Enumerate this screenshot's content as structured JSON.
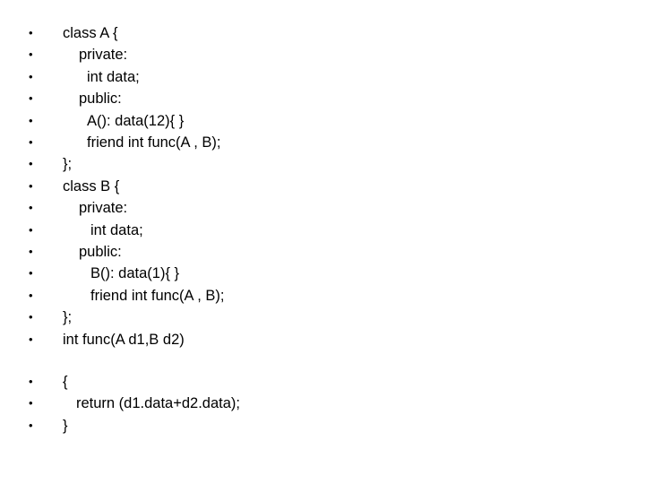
{
  "slide": {
    "bullet_glyph": "•",
    "lines": [
      {
        "text": "class A {",
        "indent": 0
      },
      {
        "text": "private:",
        "indent": 1
      },
      {
        "text": "int data;",
        "indent": 2
      },
      {
        "text": "public:",
        "indent": 1
      },
      {
        "text": "A(): data(12){ }",
        "indent": 2
      },
      {
        "text": "friend int func(A , B);",
        "indent": 2
      },
      {
        "text": "};",
        "indent": 0
      },
      {
        "text": "class B {",
        "indent": 0
      },
      {
        "text": "private:",
        "indent": 1
      },
      {
        "text": "int data;",
        "indent": 3
      },
      {
        "text": "public:",
        "indent": 1
      },
      {
        "text": "B(): data(1){ }",
        "indent": 3
      },
      {
        "text": "friend int func(A , B);",
        "indent": 3
      },
      {
        "text": "};",
        "indent": 0
      },
      {
        "text": "int func(A d1,B d2)",
        "indent": 0
      },
      {
        "text": "{",
        "indent": 0,
        "group": 2
      },
      {
        "text": "return (d1.data+d2.data);",
        "indent": 4,
        "group": 2
      },
      {
        "text": "}",
        "indent": 0,
        "group": 2
      }
    ]
  }
}
